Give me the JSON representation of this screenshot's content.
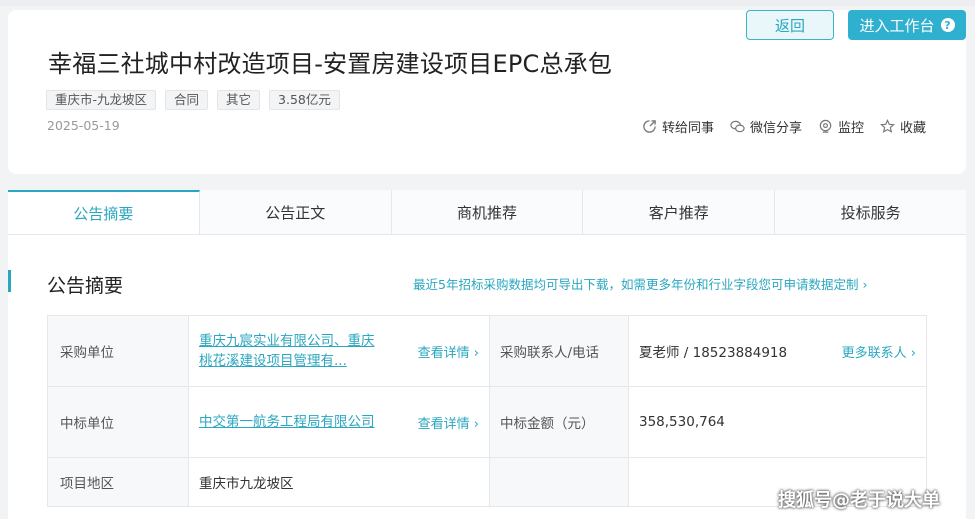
{
  "header": {
    "title": "幸福三社城中村改造项目-安置房建设项目EPC总承包",
    "tags": [
      "重庆市-九龙坡区",
      "合同",
      "其它",
      "3.58亿元"
    ],
    "date": "2025-05-19",
    "back_label": "返回",
    "workbench_label": "进入工作台",
    "actions": {
      "share_colleague": "转给同事",
      "wechat_share": "微信分享",
      "monitor": "监控",
      "favorite": "收藏"
    }
  },
  "tabs": [
    "公告摘要",
    "公告正文",
    "商机推荐",
    "客户推荐",
    "投标服务"
  ],
  "summary": {
    "title": "公告摘要",
    "export_link": "最近5年招标采购数据均可导出下载，如需更多年份和行业字段您可申请数据定制",
    "rows": {
      "purchaser_label": "采购单位",
      "purchaser_value": "重庆九宸实业有限公司、重庆桃花溪建设项目管理有...",
      "purchaser_detail": "查看详情",
      "contact_label": "采购联系人/电话",
      "contact_value": "夏老师 / 18523884918",
      "contact_more": "更多联系人",
      "winner_label": "中标单位",
      "winner_value": "中交第一航务工程局有限公司",
      "winner_detail": "查看详情",
      "amount_label": "中标金额（元）",
      "amount_value": "358,530,764",
      "region_label": "项目地区",
      "region_value": "重庆市九龙坡区"
    }
  },
  "watermark": "搜狐号@老于说大单"
}
